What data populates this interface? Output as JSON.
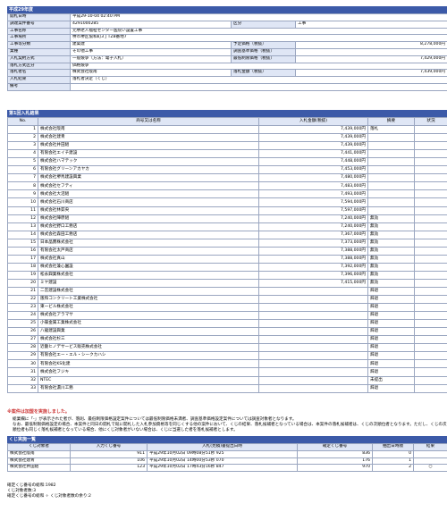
{
  "case": {
    "year_title": "平成29年度",
    "rows": [
      {
        "l": "開札日時",
        "v": "平成29-10-04 02:40 PM"
      },
      {
        "l": "調達案件番号",
        "v": "4291000285",
        "l2": "区分",
        "v2": "工事"
      },
      {
        "l": "工事名称",
        "v": "元堺老人福祉センター医院い設置工事"
      },
      {
        "l": "工事場所",
        "v": "堺市堺区協和町3丁TZ8番地7"
      },
      {
        "l": "工事等分類",
        "v": "建築建",
        "l2": "予定価格（税抜）",
        "v2": "8,278,000円"
      },
      {
        "l": "業種",
        "v": "その他工事",
        "l2": "調査基準価格（税抜）",
        "v2": ""
      },
      {
        "l": "入札契約方式",
        "v": "一般競争（方法：電子入札）",
        "l2": "最低制限価格（税抜）",
        "v2": "7,429,000円"
      },
      {
        "l": "落札方式区分",
        "v": "価格競争"
      },
      {
        "l": "落札者名",
        "v": "株式会社阪南",
        "l2": "落札金額（税抜）",
        "v2": "7,439,000円"
      },
      {
        "l": "入札結果",
        "v": "落札者決定（くじ）"
      },
      {
        "l": "備考",
        "v": ""
      }
    ]
  },
  "bid_section": {
    "title": "第1回入札結果",
    "headers": [
      "No.",
      "商号又は名称",
      "入札金額(税抜)",
      "摘要",
      "状況"
    ],
    "rows": [
      {
        "no": "1",
        "name": "株式会社阪南",
        "amount": "7,439,000円",
        "note": "落札"
      },
      {
        "no": "2",
        "name": "株式会社建青",
        "amount": "7,439,000円",
        "note": ""
      },
      {
        "no": "3",
        "name": "株式会社井田組",
        "amount": "7,439,000円",
        "note": ""
      },
      {
        "no": "4",
        "name": "有限会社エイチ建設",
        "amount": "7,441,000円",
        "note": ""
      },
      {
        "no": "5",
        "name": "株式会社ハマテック",
        "amount": "7,448,000円",
        "note": ""
      },
      {
        "no": "6",
        "name": "有限会社グリーンアカヤカ",
        "amount": "7,453,000円",
        "note": ""
      },
      {
        "no": "7",
        "name": "株式会社堺馬建設興業",
        "amount": "7,480,000円",
        "note": ""
      },
      {
        "no": "8",
        "name": "株式会社セフティ",
        "amount": "7,483,000円",
        "note": ""
      },
      {
        "no": "9",
        "name": "株式会社大沼組",
        "amount": "7,493,000円",
        "note": ""
      },
      {
        "no": "10",
        "name": "株式会社石川商店",
        "amount": "7,594,000円",
        "note": ""
      },
      {
        "no": "11",
        "name": "株式会社林茹央",
        "amount": "7,597,000円",
        "note": ""
      },
      {
        "no": "12",
        "name": "株式会社陣原組",
        "amount": "7,240,000円",
        "note": "無効"
      },
      {
        "no": "13",
        "name": "株式会社野口工務店",
        "amount": "7,240,000円",
        "note": "無効"
      },
      {
        "no": "14",
        "name": "株式会社森田工務店",
        "amount": "7,367,000円",
        "note": "無効"
      },
      {
        "no": "15",
        "name": "日本晶贋株式会社",
        "amount": "7,373,000円",
        "note": "無効"
      },
      {
        "no": "16",
        "name": "有限会社太戸商店",
        "amount": "7,388,000円",
        "note": "無効"
      },
      {
        "no": "17",
        "name": "株式会社真山",
        "amount": "7,388,000円",
        "note": "無効"
      },
      {
        "no": "18",
        "name": "株式会社兼心園設",
        "amount": "7,392,000円",
        "note": "無効"
      },
      {
        "no": "19",
        "name": "松永興業株式会社",
        "amount": "7,396,000円",
        "note": "無効"
      },
      {
        "no": "20",
        "name": "ミヤ建設",
        "amount": "7,415,000円",
        "note": "無効"
      },
      {
        "no": "21",
        "name": "二宮建設株式会社",
        "amount": "",
        "note": "辞退"
      },
      {
        "no": "22",
        "name": "阪和コンクリート工業株式会社",
        "amount": "",
        "note": "辞退"
      },
      {
        "no": "23",
        "name": "東一ビル株式会社",
        "amount": "",
        "note": "辞退"
      },
      {
        "no": "24",
        "name": "株式会社アラマサ",
        "amount": "",
        "note": "辞退"
      },
      {
        "no": "25",
        "name": "小篠金属工業株式会社",
        "amount": "",
        "note": "辞退"
      },
      {
        "no": "26",
        "name": "八龍建設興業",
        "amount": "",
        "note": "辞退"
      },
      {
        "no": "27",
        "name": "株式会社杉三",
        "amount": "",
        "note": "辞退"
      },
      {
        "no": "28",
        "name": "近畿ヒノデサービス販売株式会社",
        "amount": "",
        "note": "辞退"
      },
      {
        "no": "29",
        "name": "有限会社エー・エル・シークカハシ",
        "amount": "",
        "note": "辞退"
      },
      {
        "no": "30",
        "name": "有限会社KS化建",
        "amount": "",
        "note": "辞退"
      },
      {
        "no": "31",
        "name": "株式会社フジキ",
        "amount": "",
        "note": "辞退"
      },
      {
        "no": "32",
        "name": "NTEC",
        "amount": "",
        "note": "未提出"
      },
      {
        "no": "33",
        "name": "有限会社濃川工務",
        "amount": "",
        "note": "辞退"
      }
    ]
  },
  "notes": {
    "title": "※案件は加盟を実施しました。",
    "p1": "総業欄に「-」が表示された者が、落則、最低制限価格設定案件については最低制限価格未満者、調査基準価格設定案件については調査対象者となります。",
    "p2": "なお、最低制限価格設定の場合、本案件と同日の開札で既に開札した入札参加資格等を同じくする他の案件において、くじの結果、落札候補者となっている場合は、本案件の落札候補者は、くじの次順位者となります。ただし、くじの次順位者も同じく落札候補者となっている場合、他にくじ対象者がいない場合は、くじに当選した者を落札候補者とします。"
  },
  "lottery": {
    "title": "くじ実施一覧",
    "headers": [
      "くじ対象者",
      "入力くじ番号",
      "入札(見積)書提出日時",
      "確定くじ番号",
      "抽出日時順",
      "結果"
    ],
    "rows": [
      {
        "name": "株式会社阪南",
        "input": "911",
        "datetime": "平成29年10月02日 09時08分51秒 925",
        "fixed": "836",
        "order": "0",
        "result": ""
      },
      {
        "name": "株式会社建青",
        "input": "106",
        "datetime": "平成29年10月02日 14時00分53秒 070",
        "fixed": "176",
        "order": "1",
        "result": ""
      },
      {
        "name": "株式会社井田組",
        "input": "123",
        "datetime": "平成29年10月02日 17時43分16秒 847",
        "fixed": "970",
        "order": "2",
        "result": "○"
      }
    ]
  },
  "summary": {
    "line1": "確定くじ番号の総和:1982",
    "line2": "くじ対象者数:3",
    "line3": "確定くじ番号の総和 ÷ くじ対象者数の余り:2"
  }
}
